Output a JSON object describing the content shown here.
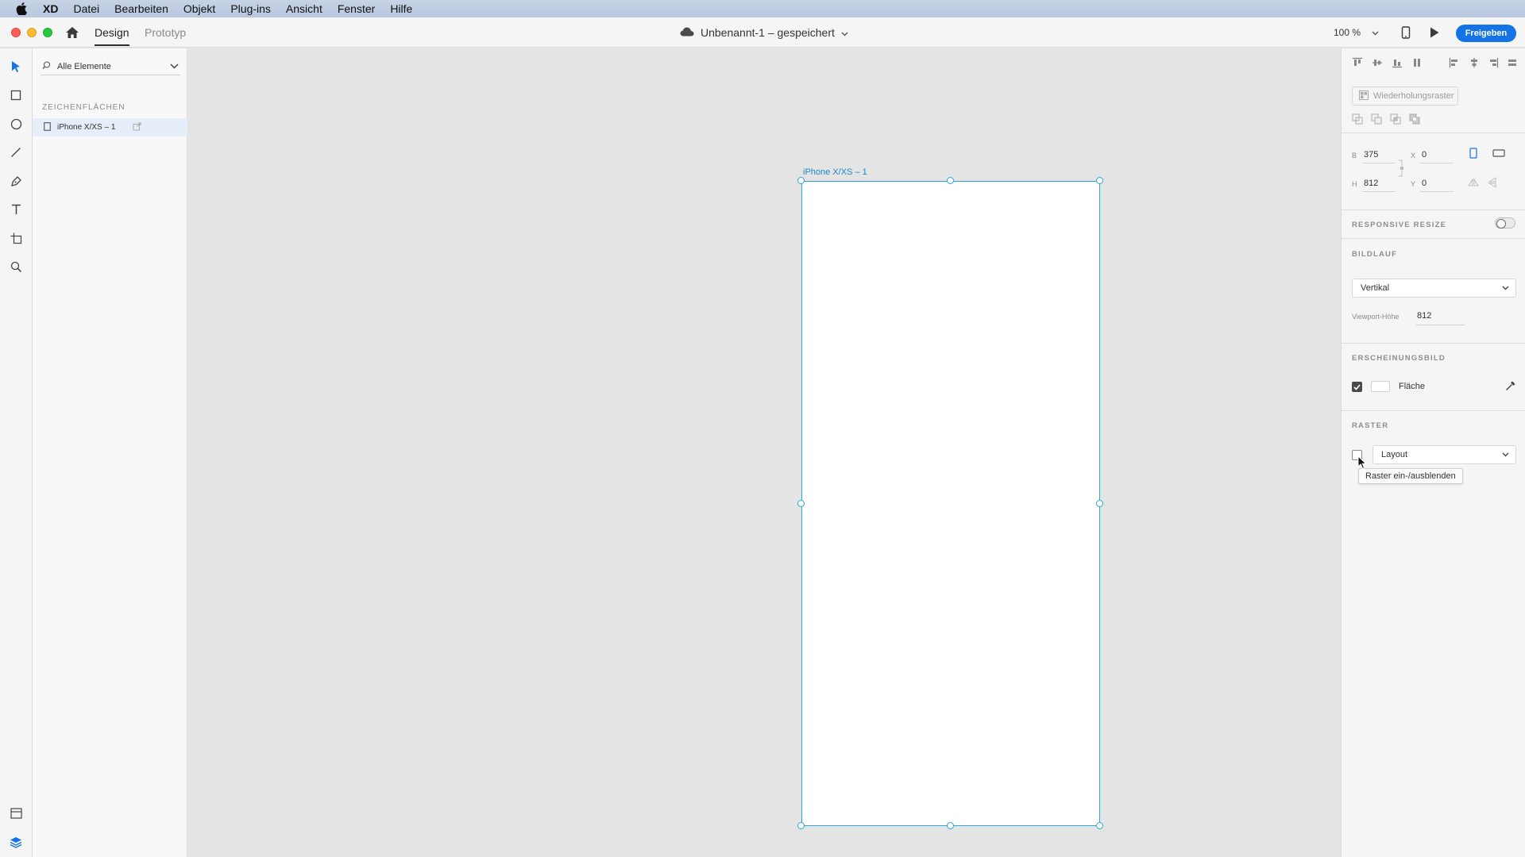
{
  "menubar": {
    "app": "XD",
    "items": [
      "Datei",
      "Bearbeiten",
      "Objekt",
      "Plug-ins",
      "Ansicht",
      "Fenster",
      "Hilfe"
    ]
  },
  "titlebar": {
    "tab_design": "Design",
    "tab_prototype": "Prototyp",
    "doc_title": "Unbenannt-1 – gespeichert",
    "zoom": "100 %",
    "share_label": "Freigeben"
  },
  "layers": {
    "filter_label": "Alle Elemente",
    "heading": "ZEICHENFLÄCHEN",
    "artboards": [
      "iPhone X/XS – 1"
    ]
  },
  "canvas": {
    "artboard_label": "iPhone X/XS – 1"
  },
  "inspector": {
    "repeat_grid": "Wiederholungsraster",
    "width_label": "B",
    "width": "375",
    "x_label": "X",
    "x": "0",
    "height_label": "H",
    "height": "812",
    "y_label": "Y",
    "y": "0",
    "responsive_resize": "RESPONSIVE RESIZE",
    "scroll_heading": "BILDLAUF",
    "scroll_value": "Vertikal",
    "viewport_label": "Viewport-Höhe",
    "viewport_value": "812",
    "appearance_heading": "ERSCHEINUNGSBILD",
    "fill_label": "Fläche",
    "fill_checked": true,
    "grid_heading": "RASTER",
    "grid_value": "Layout",
    "grid_checked": false,
    "tooltip": "Raster ein-/ausblenden"
  },
  "colors": {
    "accent": "#1473e6",
    "selection": "#2aa6d6"
  }
}
